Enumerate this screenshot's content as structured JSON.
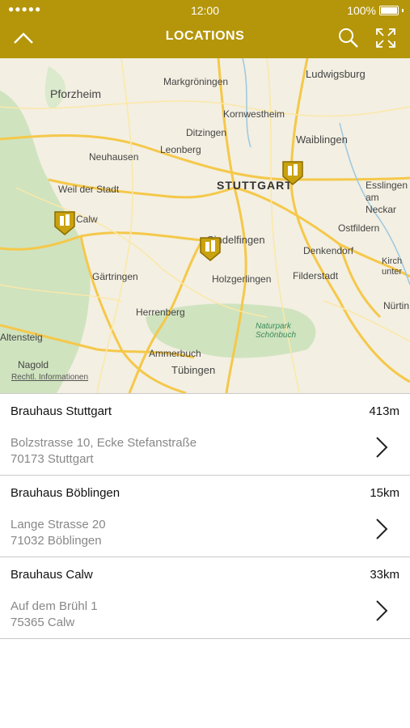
{
  "status_bar": {
    "signal": "●●●●●",
    "time": "12:00",
    "battery": "100%"
  },
  "header": {
    "title": "LOCATIONS"
  },
  "map": {
    "legal": "Rechtl. Informationen",
    "labels": {
      "pforzheim": "Pforzheim",
      "markgroeningen": "Markgröningen",
      "ludwigsburg": "Ludwigsburg",
      "kornwestheim": "Kornwestheim",
      "ditzingen": "Ditzingen",
      "waiblingen": "Waiblingen",
      "neuhausen": "Neuhausen",
      "leonberg": "Leonberg",
      "weil": "Weil der Stadt",
      "stuttgart": "STUTTGART",
      "esslingen": "Esslingen am Neckar",
      "calw": "Calw",
      "sindelfingen": "Sindelfingen",
      "ostfildern": "Ostfildern",
      "denkendorf": "Denkendorf",
      "gaertringen": "Gärtringen",
      "holzgerlingen": "Holzgerlingen",
      "filderstadt": "Filderstadt",
      "kirch": "Kirch unter",
      "herrenberg": "Herrenberg",
      "nuertingen": "Nürtin",
      "altensteig": "Altensteig",
      "naturpark": "Naturpark Schönbuch",
      "ammerbuch": "Ammerbuch",
      "nagold": "Nagold",
      "tuebingen": "Tübingen"
    }
  },
  "locations": [
    {
      "name": "Brauhaus Stuttgart",
      "distance": "413m",
      "address_line1": "Bolzstrasse 10, Ecke Stefanstraße",
      "address_line2": "70173 Stuttgart"
    },
    {
      "name": "Brauhaus Böblingen",
      "distance": "15km",
      "address_line1": "Lange Strasse 20",
      "address_line2": "71032 Böblingen"
    },
    {
      "name": "Brauhaus Calw",
      "distance": "33km",
      "address_line1": "Auf dem Brühl 1",
      "address_line2": "75365 Calw"
    }
  ],
  "colors": {
    "accent": "#b5960a",
    "forest": "#c9e0b9",
    "road": "#f5c84a"
  },
  "icons": {
    "back": "chevron-up-icon",
    "search": "search-icon",
    "expand": "expand-icon",
    "row": "chevron-right-icon",
    "pin": "brewery-pin-icon"
  }
}
